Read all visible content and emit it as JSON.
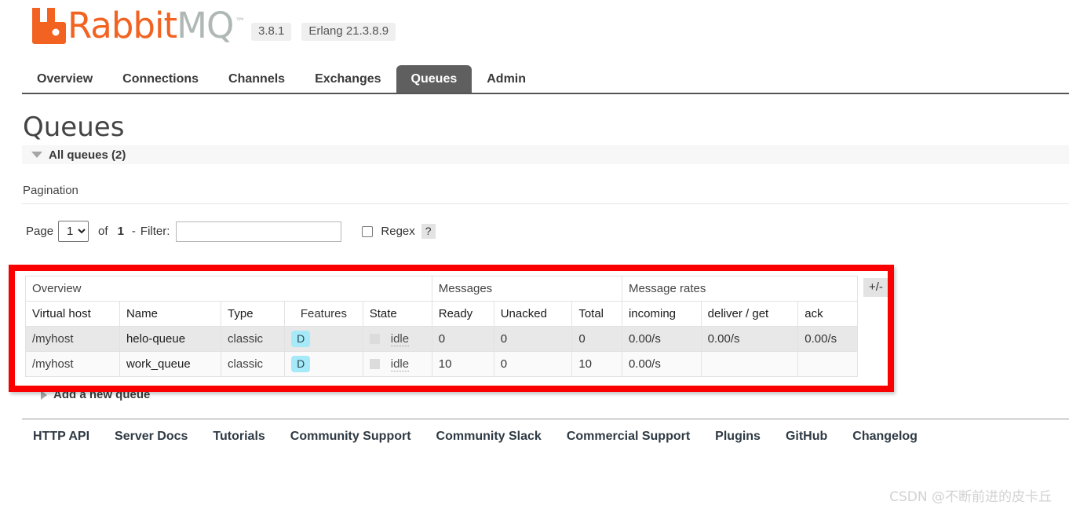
{
  "header": {
    "logo_rabbit": "Rabbit",
    "logo_mq": "MQ",
    "logo_tm": "™",
    "version": "3.8.1",
    "erlang_version": "Erlang 21.3.8.9"
  },
  "nav": {
    "tabs": [
      {
        "label": "Overview",
        "active": false
      },
      {
        "label": "Connections",
        "active": false
      },
      {
        "label": "Channels",
        "active": false
      },
      {
        "label": "Exchanges",
        "active": false
      },
      {
        "label": "Queues",
        "active": true
      },
      {
        "label": "Admin",
        "active": false
      }
    ]
  },
  "main": {
    "page_title": "Queues",
    "section_title": "All queues (2)",
    "pagination_label": "Pagination",
    "pager": {
      "page_word": "Page",
      "page_value": "1",
      "page_options": [
        "1"
      ],
      "of_word": "of",
      "total_pages": "1",
      "dash": "-",
      "filter_label": "Filter:",
      "filter_value": "",
      "filter_placeholder": "",
      "regex_label": "Regex",
      "regex_checked": false,
      "help_label": "?"
    },
    "table": {
      "plus_minus": "+/-",
      "group_headers": [
        {
          "label": "Overview",
          "span": 5
        },
        {
          "label": "Messages",
          "span": 3
        },
        {
          "label": "Message rates",
          "span": 3
        }
      ],
      "columns": [
        {
          "label": "Virtual host",
          "bold": true,
          "align": "left"
        },
        {
          "label": "Name",
          "bold": true,
          "align": "left"
        },
        {
          "label": "Type",
          "bold": true,
          "align": "left"
        },
        {
          "label": "Features",
          "bold": false,
          "align": "left"
        },
        {
          "label": "State",
          "bold": true,
          "align": "left"
        },
        {
          "label": "Ready",
          "bold": true,
          "align": "left"
        },
        {
          "label": "Unacked",
          "bold": true,
          "align": "left"
        },
        {
          "label": "Total",
          "bold": true,
          "align": "left"
        },
        {
          "label": "incoming",
          "bold": true,
          "align": "left"
        },
        {
          "label": "deliver / get",
          "bold": true,
          "align": "left"
        },
        {
          "label": "ack",
          "bold": true,
          "align": "left"
        }
      ],
      "rows": [
        {
          "vhost": "/myhost",
          "name": "helo-queue",
          "type": "classic",
          "features": "D",
          "state": "idle",
          "ready": "0",
          "unacked": "0",
          "total": "0",
          "incoming": "0.00/s",
          "deliver_get": "0.00/s",
          "ack": "0.00/s"
        },
        {
          "vhost": "/myhost",
          "name": "work_queue",
          "type": "classic",
          "features": "D",
          "state": "idle",
          "ready": "10",
          "unacked": "0",
          "total": "10",
          "incoming": "0.00/s",
          "deliver_get": "",
          "ack": ""
        }
      ]
    },
    "add_queue_label": "Add a new queue"
  },
  "footer": {
    "links": [
      "HTTP API",
      "Server Docs",
      "Tutorials",
      "Community Support",
      "Community Slack",
      "Commercial Support",
      "Plugins",
      "GitHub",
      "Changelog"
    ]
  },
  "watermark": "CSDN @不断前进的皮卡丘",
  "colors": {
    "brand_orange": "#f26322",
    "logo_gray": "#b0b8b4",
    "active_tab_bg": "#605f5f",
    "feature_badge_bg": "#a6e9f9",
    "annotation_red": "#fb0000",
    "row_alt_bg": "#e8e8e8"
  }
}
